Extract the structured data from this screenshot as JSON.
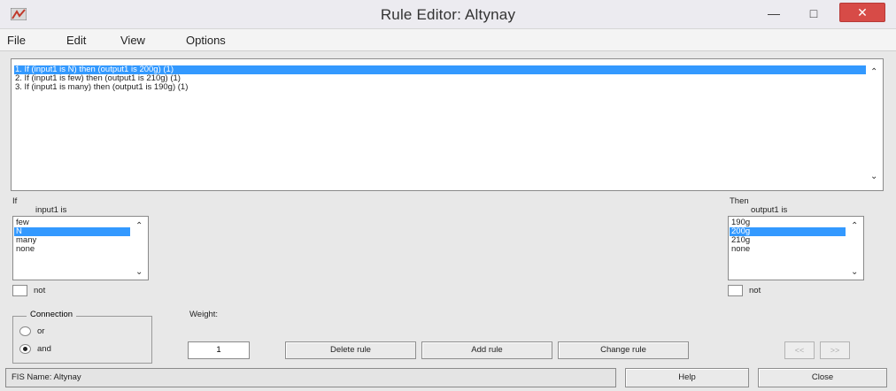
{
  "window": {
    "title": "Rule Editor: Altynay"
  },
  "menu": [
    "File",
    "Edit",
    "View",
    "Options"
  ],
  "rules": {
    "items": [
      "1. If (input1 is N) then (output1 is 200g) (1)",
      "2. If (input1 is few) then (output1 is 210g) (1)",
      "3. If (input1 is many) then (output1 is 190g) (1)"
    ],
    "selected_index": 0
  },
  "antecedent": {
    "section_label": "If",
    "var_label": "input1 is",
    "options": [
      "few",
      "N",
      "many",
      "none"
    ],
    "selected_index": 1,
    "not_label": "not",
    "not_checked": false
  },
  "consequent": {
    "section_label": "Then",
    "var_label": "output1 is",
    "options": [
      "190g",
      "200g",
      "210g",
      "none"
    ],
    "selected_index": 1,
    "not_label": "not",
    "not_checked": false
  },
  "connection": {
    "legend": "Connection",
    "options": [
      "or",
      "and"
    ],
    "selected": "and"
  },
  "weight": {
    "label": "Weight:",
    "value": "1"
  },
  "buttons": {
    "delete": "Delete rule",
    "add": "Add rule",
    "change": "Change rule",
    "prev": "<<",
    "next": ">>"
  },
  "status": {
    "fis_name": "FIS Name: Altynay",
    "help": "Help",
    "close": "Close"
  },
  "colors": {
    "selection": "#3399ff",
    "close_button": "#d74b47"
  }
}
